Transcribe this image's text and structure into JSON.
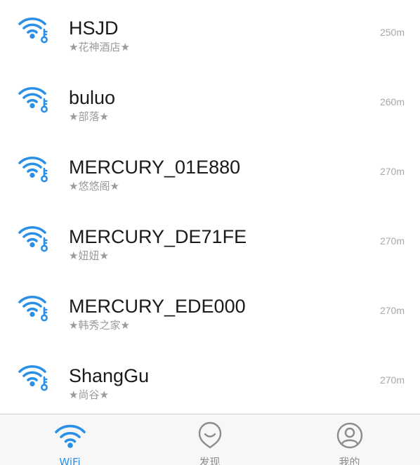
{
  "networks": [
    {
      "ssid": "HSJD",
      "alias": "★花神酒店★",
      "distance": "250m",
      "icon": "wifi-key-icon"
    },
    {
      "ssid": "buluo",
      "alias": "★部落★",
      "distance": "260m",
      "icon": "wifi-key-icon"
    },
    {
      "ssid": "MERCURY_01E880",
      "alias": "★悠悠阁★",
      "distance": "270m",
      "icon": "wifi-key-icon"
    },
    {
      "ssid": "MERCURY_DE71FE",
      "alias": "★妞妞★",
      "distance": "270m",
      "icon": "wifi-key-icon"
    },
    {
      "ssid": "MERCURY_EDE000",
      "alias": "★韩秀之家★",
      "distance": "270m",
      "icon": "wifi-key-icon"
    },
    {
      "ssid": "ShangGu",
      "alias": "★尚谷★",
      "distance": "270m",
      "icon": "wifi-key-icon"
    }
  ],
  "tabs": [
    {
      "label": "WiFi",
      "icon": "wifi-icon",
      "active": true
    },
    {
      "label": "发现",
      "icon": "discover-icon",
      "active": false
    },
    {
      "label": "我的",
      "icon": "profile-icon",
      "active": false
    }
  ],
  "colors": {
    "accent": "#2a8fe6",
    "tab_inactive": "#8c8c8c",
    "ssid_text": "#1a1a1a",
    "alias_text": "#9a9a9a",
    "distance_text": "#a8a8a8",
    "tab_bar_bg": "#f7f7f7"
  }
}
